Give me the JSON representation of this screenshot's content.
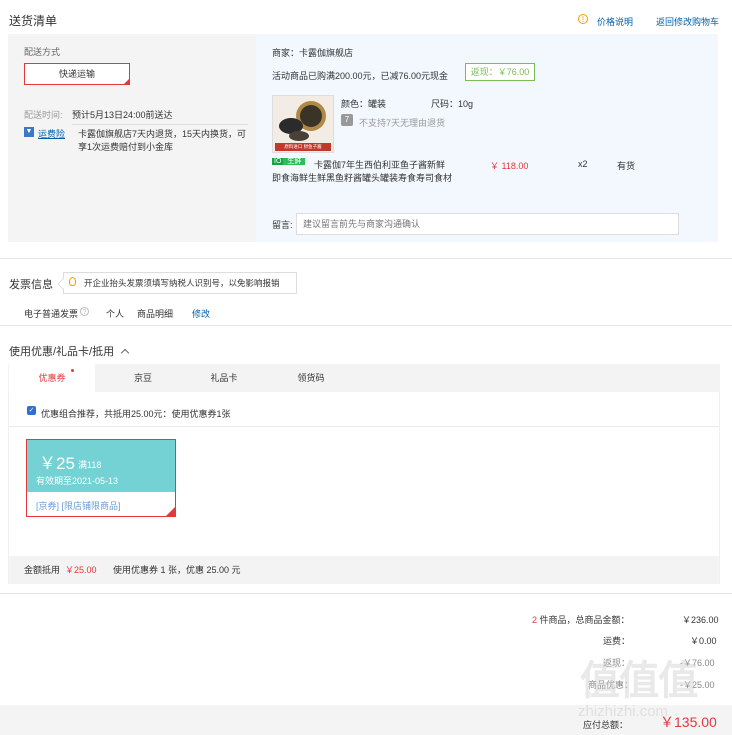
{
  "header": {
    "title": "送货清单",
    "price_note": "价格说明",
    "back_cart": "返回修改购物车"
  },
  "delivery": {
    "method_label": "配送方式",
    "method_value": "快递运输",
    "time_label": "配送时间:",
    "time_value": "预计5月13日24:00前送达",
    "insurance_link": "运费险",
    "insurance_text_1": "卡露伽旗舰店7天内退货，15天内换货，可",
    "insurance_text_2": "享1次运费赔付到小金库"
  },
  "store": {
    "label": "商家：卡露伽旗舰店",
    "promo": "活动商品已购满200.00元，已减76.00元现金",
    "cashback": "返现：￥76.00"
  },
  "product": {
    "color": "颜色：罐装",
    "size": "尺码：10g",
    "no_return": "不支持7天无理由退货",
    "tag_a": "IO",
    "tag_b": "生鲜",
    "name_1": "卡露伽7年生西伯利亚鱼子酱新鲜",
    "name_2": "即食海鲜生鲜黑鱼籽酱罐头罐装寿食寿司食材",
    "price": "￥ 118.00",
    "qty": "x2",
    "stock": "有货",
    "thumb_caption": "原料进口 鲟鱼子酱"
  },
  "remark": {
    "label": "留言:",
    "placeholder": "建议留言前先与商家沟通确认"
  },
  "invoice": {
    "title": "发票信息",
    "tip": "开企业抬头发票须填写纳税人识别号，以免影响报销",
    "type": "电子普通发票",
    "person": "个人",
    "detail": "商品明细",
    "edit": "修改"
  },
  "coupons": {
    "section_title": "使用优惠/礼品卡/抵用",
    "tabs": [
      "优惠券",
      "京豆",
      "礼品卡",
      "领货码"
    ],
    "combo_text": "优惠组合推荐，共抵用25.00元：使用优惠券1张",
    "coupon_amount": "￥25",
    "coupon_threshold": "满118",
    "coupon_expiry": "有效期至2021-05-13",
    "coupon_scope": "[京券] [限店铺限商品]",
    "footer_label": "金额抵用",
    "footer_amount": "￥25.00",
    "footer_detail": "使用优惠券 1 张，优惠 25.00 元"
  },
  "summary": {
    "count": "2",
    "count_label": "件商品，总商品金额：",
    "total": "￥236.00",
    "shipping_label": "运费：",
    "shipping": "￥0.00",
    "row3_label": "返现：",
    "row3": "-￥76.00",
    "row4_label": "商品优惠：",
    "row4": "-￥25.00",
    "payable_label": "应付总额：",
    "payable": "￥135.00"
  },
  "watermark": {
    "text": "值 值 值",
    "site": "zhizhizhi.com"
  },
  "colors": {
    "accent_red": "#e4393c",
    "link_blue": "#005ea7",
    "coupon_teal": "#74d2d4",
    "return_green": "#7abd54"
  }
}
